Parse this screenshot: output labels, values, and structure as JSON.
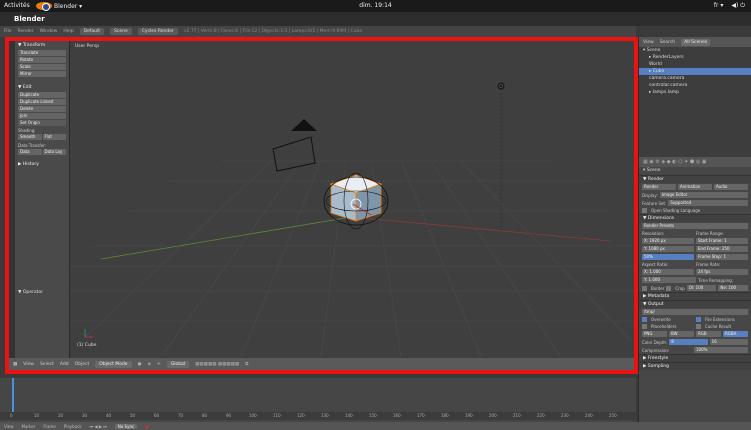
{
  "topbar": {
    "activities": "Activités",
    "app": "Blender ▾",
    "clock": "dim. 19:14",
    "lang": "fr ▾",
    "power": "◀) ⏻"
  },
  "window": {
    "title": "Blender"
  },
  "info_header": {
    "menus": [
      "File",
      "Render",
      "Window",
      "Help"
    ],
    "layout": "Default",
    "scene": "Scene",
    "engine": "Cycles Render",
    "stats": "v2.77 | Verts:8 | Faces:6 | Tris:12 | Objects:1/3 | Lamps:0/1 | Mem:9.69M | Cube"
  },
  "tools": {
    "transform_title": "▼ Transform",
    "transform": [
      "Translate",
      "Rotate",
      "Scale",
      "Mirror"
    ],
    "edit_title": "▼ Edit",
    "edit": [
      "Duplicate",
      "Duplicate Linked",
      "Delete",
      "Join"
    ],
    "set_origin": "Set Origin",
    "shading_label": "Shading:",
    "shading": [
      "Smooth",
      "Flat"
    ],
    "data_label": "Data Transfer:",
    "data": [
      "Data",
      "Data Lay"
    ],
    "history": "▶ History",
    "operator": "▼ Operator"
  },
  "viewport": {
    "label": "User Persp",
    "object": "(1) Cube",
    "menus": [
      "View",
      "Select",
      "Add",
      "Object"
    ],
    "mode": "Object Mode",
    "pivot": "Global"
  },
  "timeline": {
    "ticks": [
      "0",
      "10",
      "20",
      "30",
      "40",
      "50",
      "60",
      "70",
      "80",
      "90",
      "100",
      "110",
      "120",
      "130",
      "140",
      "150",
      "160",
      "170",
      "180",
      "190",
      "200",
      "210",
      "220",
      "230",
      "240",
      "250"
    ],
    "menus": [
      "View",
      "Marker",
      "Frame",
      "Playback"
    ],
    "sync": "No Sync"
  },
  "outliner": {
    "tabs": [
      "View",
      "Search",
      "All Scenes"
    ],
    "items": [
      {
        "label": "▾ Scene",
        "indent": 1
      },
      {
        "label": "▸ RenderLayers",
        "indent": 2
      },
      {
        "label": "World",
        "indent": 2
      },
      {
        "label": "▸ Cube",
        "indent": 2
      },
      {
        "label": "camera.camera",
        "indent": 2
      },
      {
        "label": "controlar.camera",
        "indent": 2
      },
      {
        "label": "▸ lamps.lamp",
        "indent": 2
      }
    ]
  },
  "properties": {
    "crumb": "▾ Scene",
    "render": "▼ Render",
    "render_tabs": [
      "Render",
      "Animation",
      "Audio"
    ],
    "display_label": "Display:",
    "display": "Image Editor",
    "feature_label": "Feature Set:",
    "feature": "Supported",
    "osl": "Open Shading Language",
    "dimensions": "▼ Dimensions",
    "presets": "Render Presets",
    "resolution": "Resolution:",
    "res_x": "X:   1920 px",
    "res_y": "Y:   1080 px",
    "res_pct": "50%",
    "frame_range": "Frame Range:",
    "start": "Start Frame: 1",
    "end": "End Frame: 250",
    "step": "Frame Step: 1",
    "aspect": "Aspect Ratio:",
    "aspect_x": "X:  1.000",
    "aspect_y": "Y:  1.000",
    "frame_rate": "Frame Rate:",
    "fps": "24 fps",
    "remap": "Time Remapping:",
    "border": "Border",
    "crop": "Crop",
    "old": "Ol: 100",
    "new": "Ne: 100",
    "metadata": "▶ Metadata",
    "output": "▼ Output",
    "path": "/tmp/",
    "overwrite": "Overwrite",
    "extensions": "File Extensions",
    "placeholders": "Placeholders",
    "cache": "Cache Result",
    "format": "PNG",
    "bw": "BW",
    "rgb": "RGB",
    "rgba": "RGBA",
    "depth_label": "Color Depth:",
    "depth8": "8",
    "depth16": "16",
    "compression": "Compression:",
    "compression_val": "100%",
    "freestyle": "▶ Freestyle",
    "sampling": "▶ Sampling"
  },
  "colors": {
    "highlight": "#e11111",
    "accent": "#5680c2",
    "lamp": "#e87d0d"
  }
}
